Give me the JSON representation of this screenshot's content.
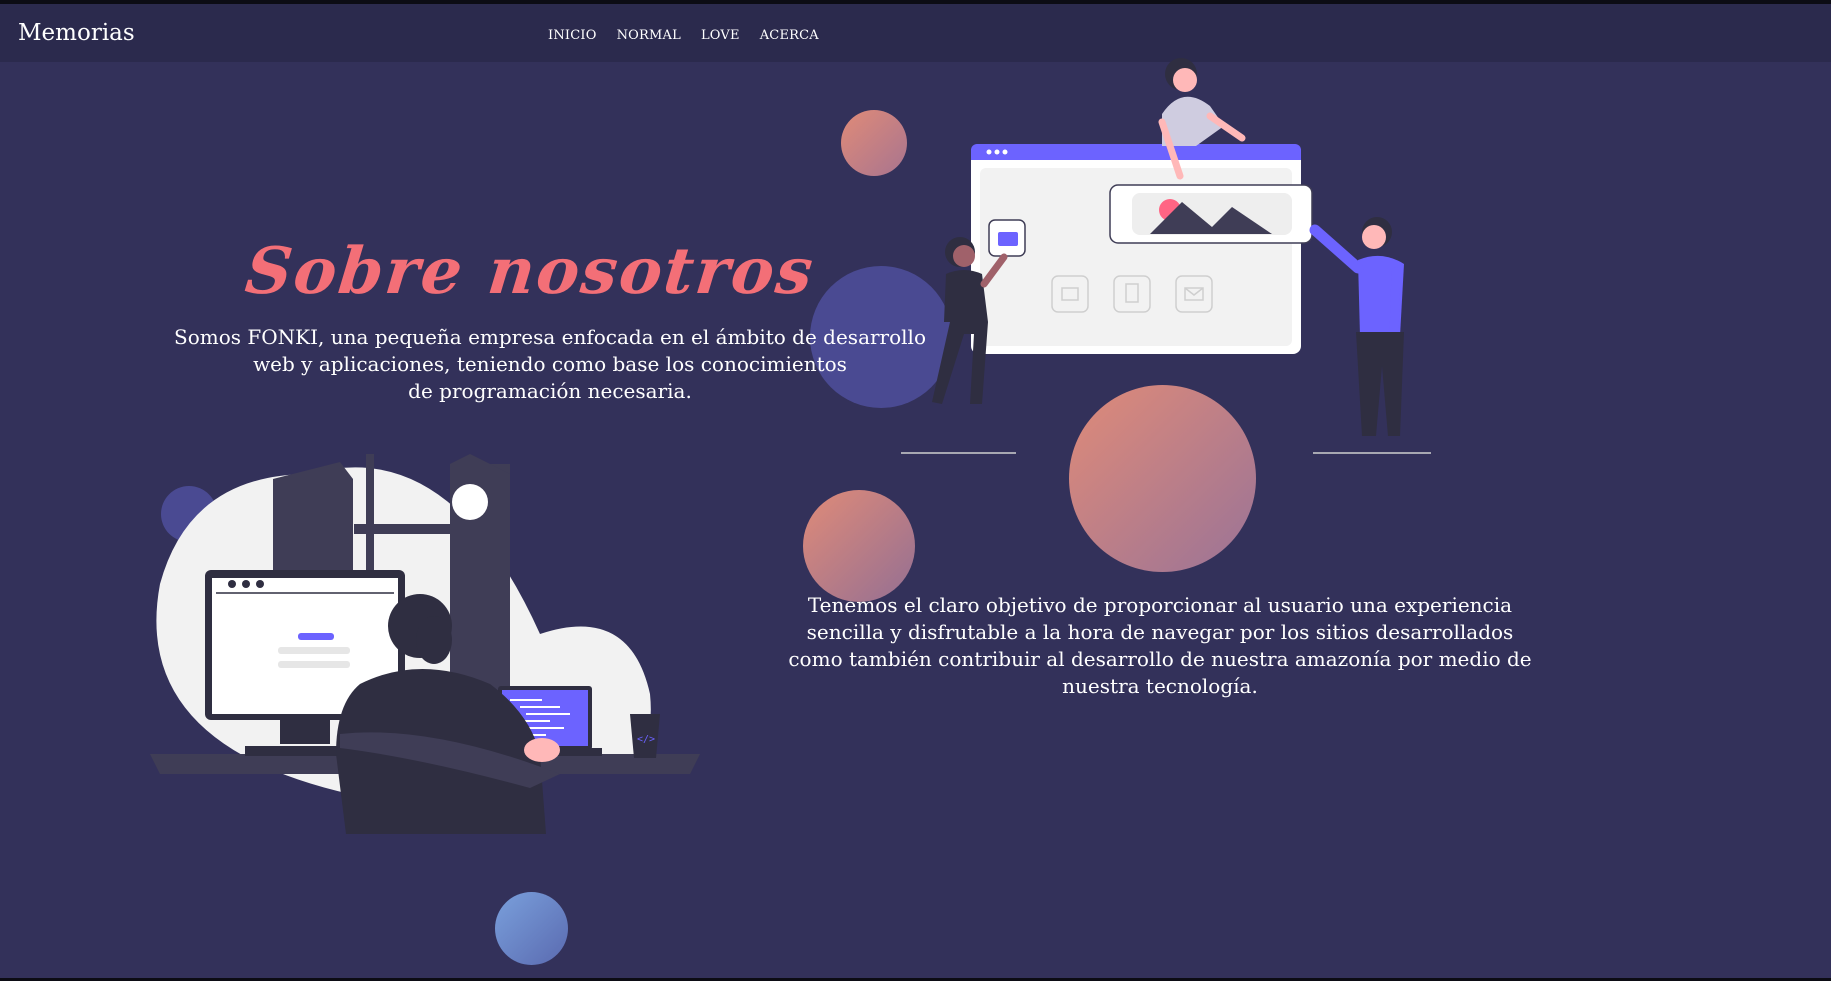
{
  "header": {
    "brand": "Memorias",
    "nav": [
      "INICIO",
      "NORMAL",
      "LOVE",
      "ACERCA"
    ]
  },
  "about": {
    "title": "Sobre nosotros",
    "intro_lines": [
      "Somos FONKI, una pequeña empresa enfocada en el ámbito de desarrollo",
      "web y aplicaciones, teniendo como base los conocimientos",
      "de programación necesaria."
    ],
    "goal_lines": [
      "Tenemos el claro objetivo de proporcionar al usuario una experiencia",
      "sencilla y disfrutable a la hora de navegar por los sitios desarrollados",
      "como también contribuir al desarrollo de nuestra amazonía por medio de",
      "nuestra tecnología."
    ]
  },
  "colors": {
    "background": "#33315a",
    "navbar": "#2b2a4d",
    "title": "#f36f77",
    "accent": "#6c63ff",
    "dark_figure": "#2f2e41"
  },
  "illustrations": [
    "team-building-website-illustration",
    "developer-at-desk-illustration"
  ]
}
